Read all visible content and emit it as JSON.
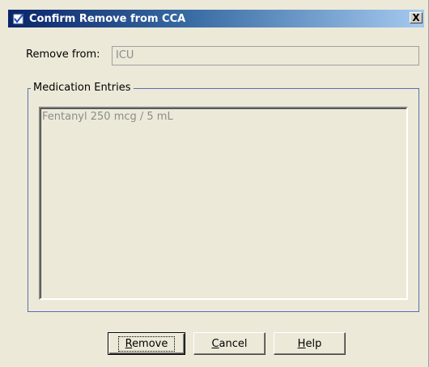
{
  "window": {
    "title": "Confirm Remove from CCA",
    "close_label": "X",
    "title_icon": "checkmark-document-icon"
  },
  "form": {
    "remove_from_label": "Remove from:",
    "remove_from_value": "ICU"
  },
  "medication_group": {
    "legend": "Medication Entries",
    "entries": [
      "Fentanyl 250 mcg / 5 mL"
    ]
  },
  "buttons": {
    "remove": {
      "label": "Remove",
      "mnemonic": "R",
      "rest": "emove"
    },
    "cancel": {
      "label": "Cancel",
      "mnemonic": "C",
      "rest": "ancel"
    },
    "help": {
      "label": "Help",
      "mnemonic": "H",
      "rest": "elp"
    }
  },
  "colors": {
    "title_gradient_start": "#0a246a",
    "title_gradient_end": "#a6caf0",
    "dialog_background": "#ece9d8",
    "group_border": "#5a6fb0",
    "disabled_text": "#8c8c8c"
  }
}
